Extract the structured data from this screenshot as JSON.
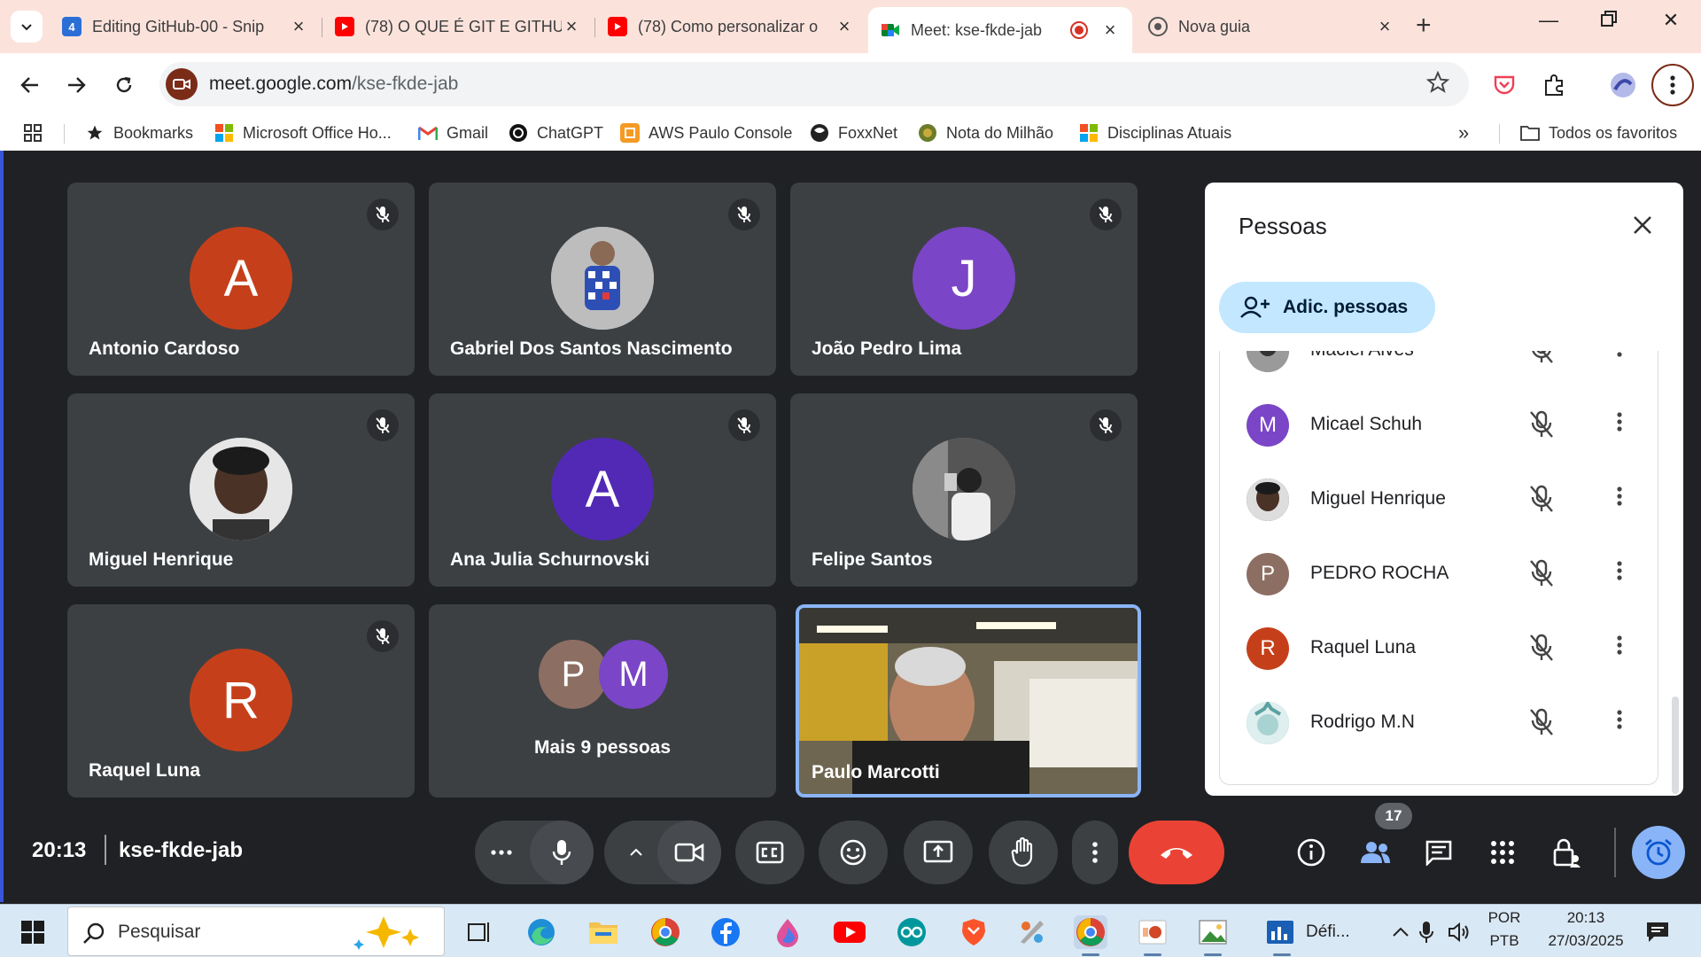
{
  "browser": {
    "tabs": [
      {
        "title": "Editing GitHub-00 - Snip",
        "icon": "snip-icon",
        "color": "#2b6fd6"
      },
      {
        "title": "(78) O QUE É GIT E GITHU",
        "icon": "youtube-icon",
        "color": "#ff0000"
      },
      {
        "title": "(78) Como personalizar o",
        "icon": "youtube-icon",
        "color": "#ff0000"
      },
      {
        "title": "Meet: kse-fkde-jab",
        "icon": "meet-icon",
        "active": true
      },
      {
        "title": "Nova guia",
        "icon": "chrome-icon"
      }
    ],
    "url_host": "meet.google.com",
    "url_path": "/kse-fkde-jab",
    "bookmarks": [
      {
        "label": "Bookmarks",
        "icon": "star-icon"
      },
      {
        "label": "Microsoft Office Ho...",
        "icon": "microsoft-icon"
      },
      {
        "label": "Gmail",
        "icon": "gmail-icon"
      },
      {
        "label": "ChatGPT",
        "icon": "chatgpt-icon"
      },
      {
        "label": "AWS Paulo Console",
        "icon": "aws-icon"
      },
      {
        "label": "FoxxNet",
        "icon": "foxxnet-icon"
      },
      {
        "label": "Nota do Milhão",
        "icon": "nota-icon"
      },
      {
        "label": "Disciplinas Atuais",
        "icon": "microsoft-icon"
      }
    ],
    "all_favorites": "Todos os favoritos"
  },
  "meet": {
    "tiles": [
      {
        "name": "Antonio Cardoso",
        "initial": "A",
        "color": "#c5401a",
        "muted": true
      },
      {
        "name": "Gabriel Dos Santos Nascimento",
        "initial": "",
        "photo": true,
        "muted": true
      },
      {
        "name": "João Pedro Lima",
        "initial": "J",
        "color": "#7b45c7",
        "muted": true
      },
      {
        "name": "Miguel Henrique",
        "initial": "",
        "photo": true,
        "muted": true
      },
      {
        "name": "Ana Julia Schurnovski",
        "initial": "A",
        "color": "#5229b5",
        "muted": true
      },
      {
        "name": "Felipe Santos",
        "initial": "",
        "photo": true,
        "muted": true
      },
      {
        "name": "Raquel Luna",
        "initial": "R",
        "color": "#c5401a",
        "muted": true
      }
    ],
    "more_tile": {
      "label": "Mais 9 pessoas",
      "initials": [
        "P",
        "M"
      ],
      "colors": [
        "#8d6e63",
        "#7b45c7"
      ]
    },
    "self_tile": {
      "name": "Paulo Marcotti"
    },
    "time": "20:13",
    "meeting_code": "kse-fkde-jab",
    "participant_count": "17"
  },
  "people_panel": {
    "title": "Pessoas",
    "add_label": "Adic. pessoas",
    "people": [
      {
        "name": "Maciel Alves",
        "initial": "",
        "photo": true,
        "color": "#777777"
      },
      {
        "name": "Micael Schuh",
        "initial": "M",
        "color": "#7b45c7"
      },
      {
        "name": "Miguel Henrique",
        "initial": "",
        "photo": true,
        "color": "#4b3a30"
      },
      {
        "name": "PEDRO ROCHA",
        "initial": "P",
        "color": "#8d6e63"
      },
      {
        "name": "Raquel Luna",
        "initial": "R",
        "color": "#c5401a"
      },
      {
        "name": "Rodrigo M.N",
        "initial": "",
        "photo": true,
        "color": "#6aa9a8"
      }
    ]
  },
  "taskbar": {
    "search_placeholder": "Pesquisar",
    "language_line1": "POR",
    "language_line2": "PTB",
    "clock_time": "20:13",
    "clock_date": "27/03/2025",
    "open_window_label": "Défi..."
  }
}
